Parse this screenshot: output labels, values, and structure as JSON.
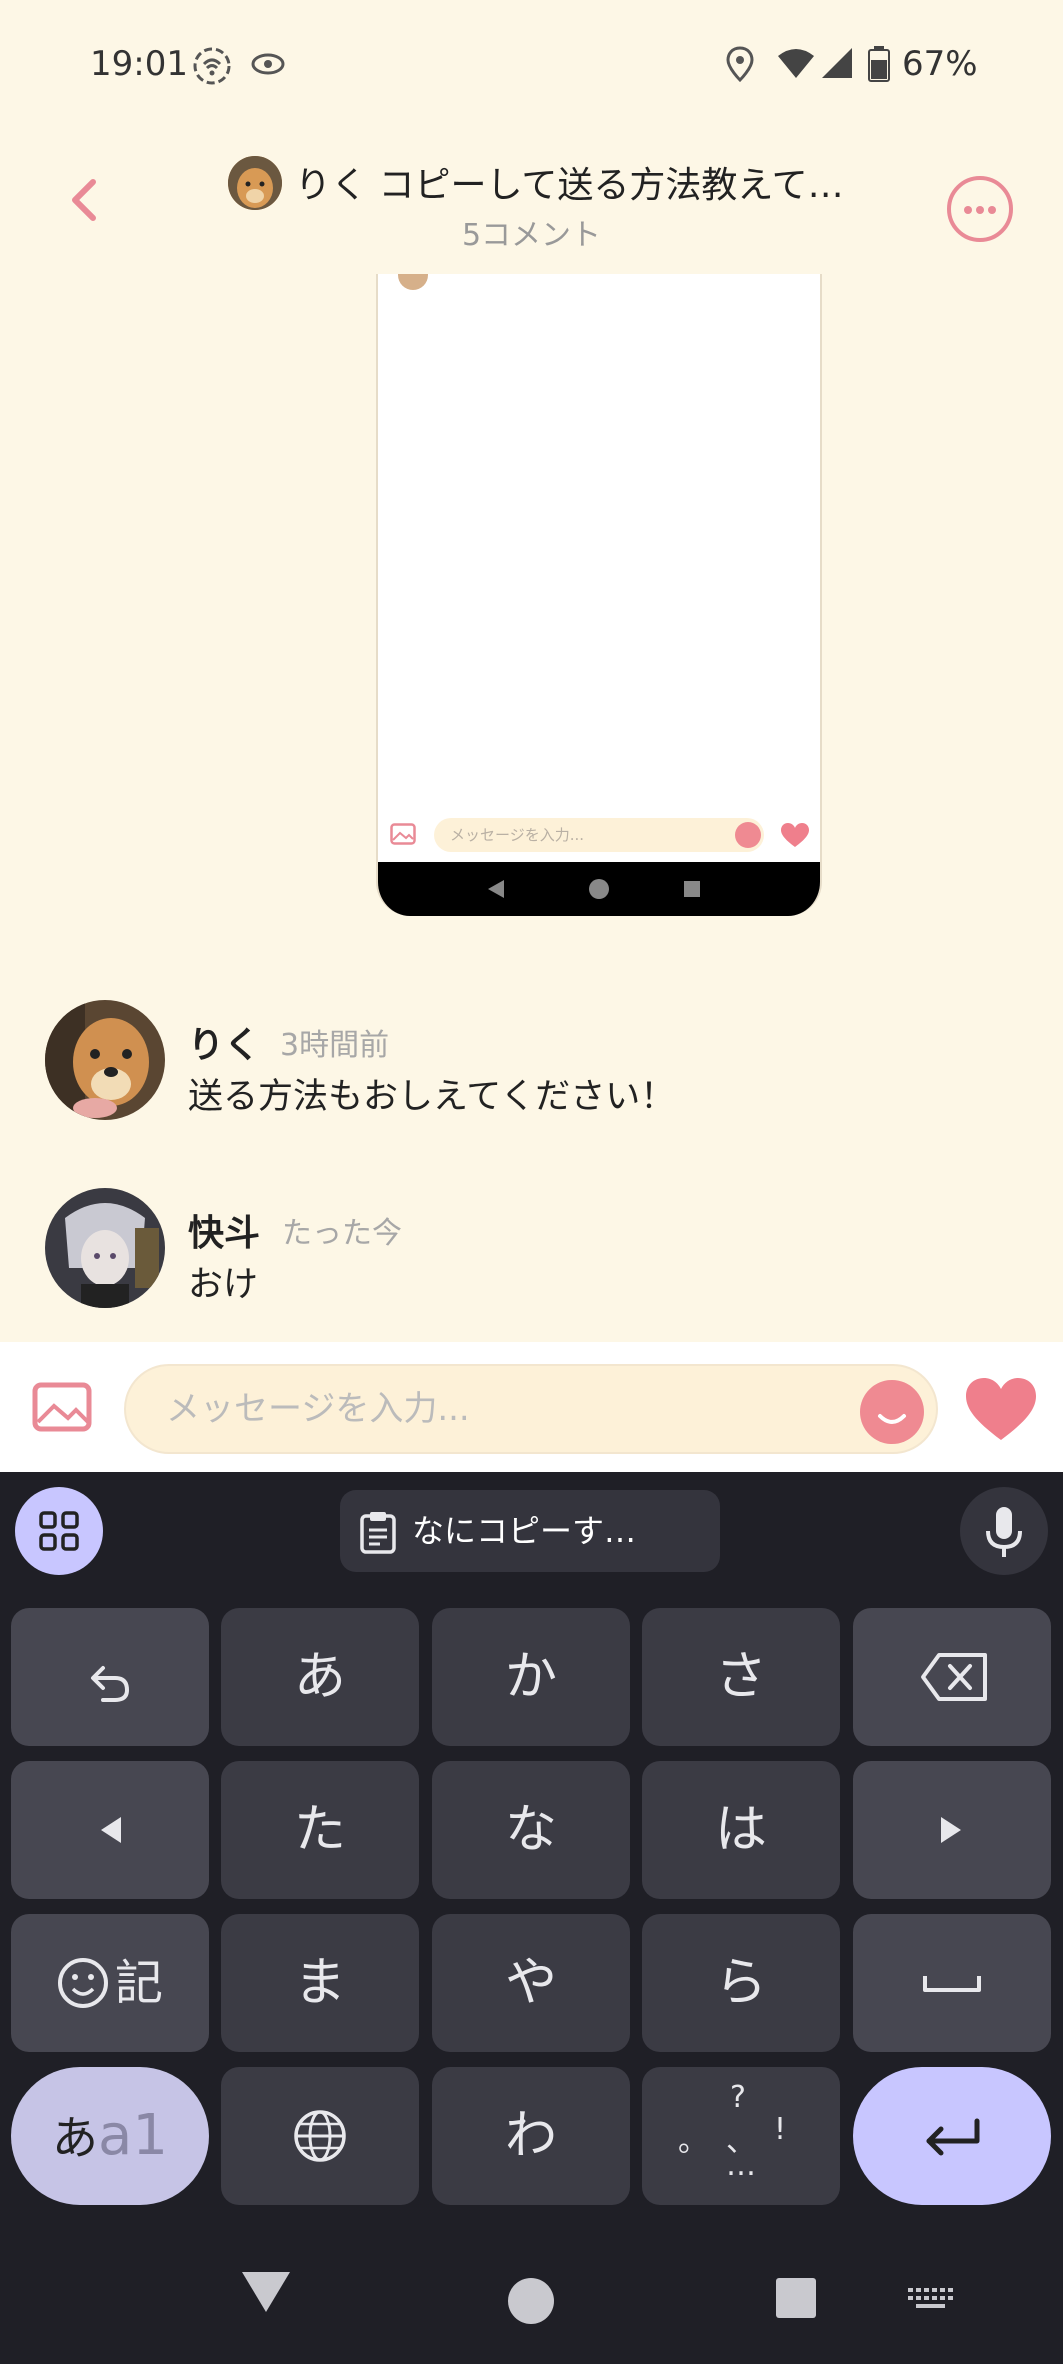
{
  "status_bar": {
    "time": "19:01",
    "battery_percent": "67%",
    "icons": [
      "hotspot-icon",
      "eye-icon",
      "location-icon",
      "wifi-icon",
      "signal-icon",
      "battery-icon"
    ]
  },
  "header": {
    "title": "りく コピーして送る方法教えて…",
    "subtitle": "5コメント",
    "back_icon": "chevron-left-icon",
    "more_icon": "more-horizontal-icon"
  },
  "embedded_screenshot": {
    "input_placeholder": "メッセージを入力..."
  },
  "comments": [
    {
      "author": "りく",
      "time": "3時間前",
      "text": "送る方法もおしえてください！"
    },
    {
      "author": "快斗",
      "time": "たった今",
      "text": "おけ"
    }
  ],
  "composer": {
    "placeholder": "メッセージを入力..."
  },
  "keyboard": {
    "clipboard_suggestion": "なにコピーす…",
    "rows": [
      [
        "undo",
        "あ",
        "か",
        "さ",
        "backspace"
      ],
      [
        "left",
        "た",
        "な",
        "は",
        "right"
      ],
      [
        "記",
        "ま",
        "や",
        "ら",
        "space"
      ],
      [
        "あa1",
        "globe",
        "わ",
        "。、？！…",
        "enter"
      ]
    ],
    "mode_label_kana": "あ",
    "mode_label_alpha": "a1",
    "emoji_key_label": "記",
    "punct_labels": [
      "?",
      "。",
      "、",
      "!",
      "…"
    ]
  },
  "colors": {
    "accent_pink": "#e98a96",
    "background": "#fdf7e6",
    "keyboard_bg": "#1f1f26",
    "keyboard_accent": "#c8c6ff"
  }
}
